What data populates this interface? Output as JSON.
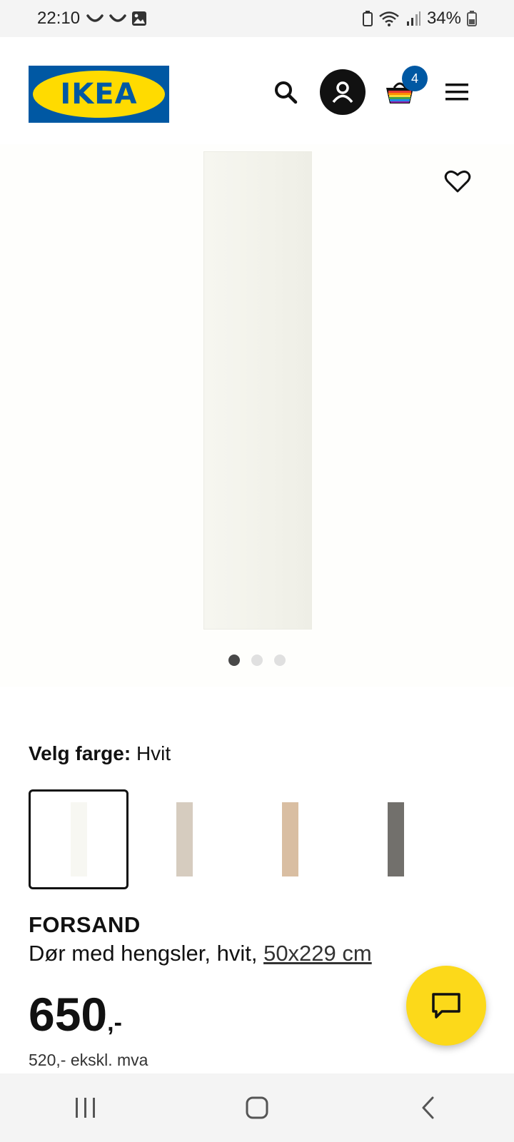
{
  "status_bar": {
    "time": "22:10",
    "battery": "34%",
    "icons": [
      "smile-icon",
      "smile-icon",
      "gallery-icon"
    ],
    "right_icons": [
      "battery-saver-icon",
      "wifi-icon",
      "signal-icon",
      "battery-icon"
    ]
  },
  "header": {
    "logo_text": "IKEA",
    "cart_count": "4",
    "colors": {
      "brand_blue": "#0058a3",
      "brand_yellow": "#ffdb00"
    }
  },
  "gallery": {
    "slides_total": 3,
    "active_slide": 1
  },
  "color_picker": {
    "label": "Velg farge:",
    "selected_value": "Hvit",
    "swatches": [
      {
        "name": "Hvit",
        "color": "#f7f7f2",
        "selected": true
      },
      {
        "name": "beige",
        "color": "#d6ccbf",
        "selected": false
      },
      {
        "name": "wood",
        "color": "#d9bea2",
        "selected": false
      },
      {
        "name": "grey",
        "color": "#72706c",
        "selected": false
      }
    ]
  },
  "product": {
    "name": "FORSAND",
    "description": "Dør med hengsler, hvit, ",
    "size": "50x229 cm",
    "price_main": "650",
    "price_suffix": ",-",
    "price_ex_vat": "520,- ekskl. mva"
  }
}
